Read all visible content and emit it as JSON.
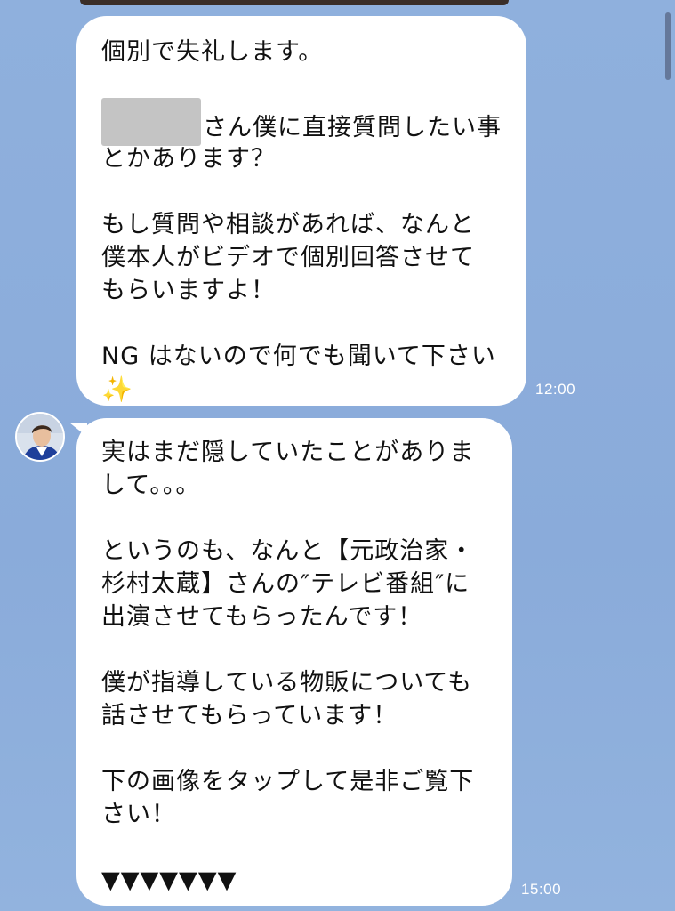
{
  "messages": [
    {
      "id": "msg1",
      "time": "12:00",
      "lines": {
        "l1": "個別で失礼します。",
        "l2_suffix": "さん僕に直接質問したい事",
        "l3": "とかあります？",
        "l4": "もし質問や相談があれば、なんと",
        "l5": "僕本人がビデオで個別回答させて",
        "l6": "もらいますよ！",
        "l7": "NG はないので何でも聞いて下さい",
        "l8": "✨"
      }
    },
    {
      "id": "msg2",
      "time": "15:00",
      "lines": {
        "l1": "実はまだ隠していたことがありま",
        "l2": "して。。。",
        "l3": "というのも、なんと【元政治家・",
        "l4": "杉村太蔵】さんの″テレビ番組″に",
        "l5": "出演させてもらったんです！",
        "l6": "僕が指導している物販についても",
        "l7": "話させてもらっています！",
        "l8": "下の画像をタップして是非ご覧下",
        "l9": "さい！",
        "l10": "▼▼▼▼▼▼▼"
      }
    }
  ],
  "colors": {
    "background": "#8fb0dd",
    "bubble": "#ffffff",
    "text": "#111111",
    "timestamp": "#ffffff",
    "redaction": "#c4c4c4"
  }
}
